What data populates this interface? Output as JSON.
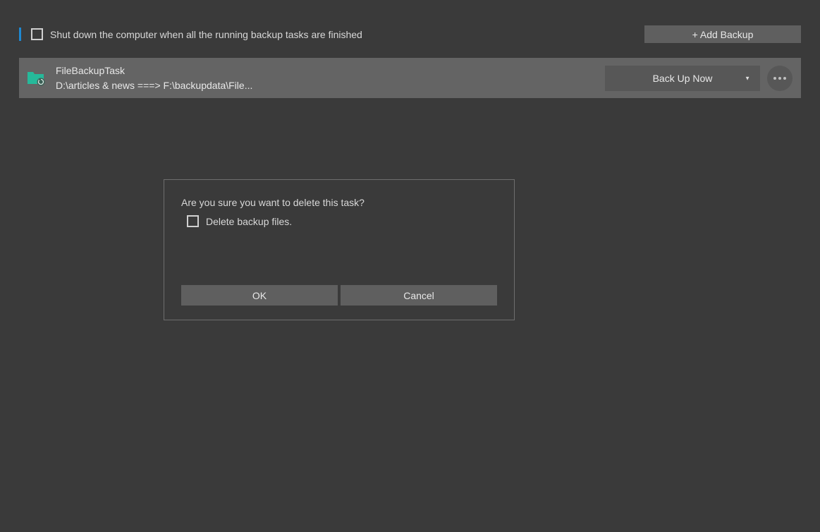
{
  "topbar": {
    "shutdown_label": "Shut down the computer when all the running backup tasks are finished",
    "add_backup_label": "+ Add Backup"
  },
  "task": {
    "name": "FileBackupTask",
    "path": "D:\\articles & news ===> F:\\backupdata\\File...",
    "backup_now_label": "Back Up Now"
  },
  "dialog": {
    "message": "Are you sure you want to delete this task?",
    "delete_files_label": "Delete backup files.",
    "ok_label": "OK",
    "cancel_label": "Cancel"
  }
}
